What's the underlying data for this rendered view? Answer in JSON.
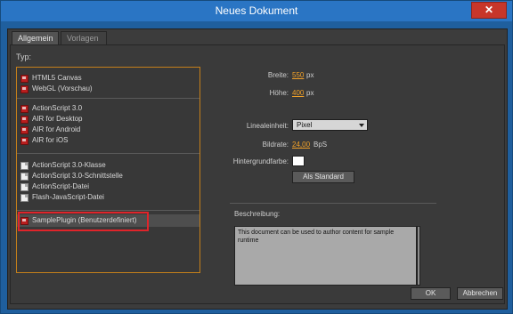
{
  "window": {
    "title": "Neues Dokument",
    "close_label": "✕"
  },
  "tabs": [
    {
      "label": "Allgemein",
      "active": true
    },
    {
      "label": "Vorlagen",
      "active": false
    }
  ],
  "typ_label": "Typ:",
  "doc_types": {
    "group1": [
      {
        "label": "HTML5 Canvas",
        "icon": "red"
      },
      {
        "label": "WebGL (Vorschau)",
        "icon": "red"
      }
    ],
    "group2": [
      {
        "label": "ActionScript 3.0",
        "icon": "red"
      },
      {
        "label": "AIR for Desktop",
        "icon": "red"
      },
      {
        "label": "AIR for Android",
        "icon": "red"
      },
      {
        "label": "AIR for iOS",
        "icon": "red"
      }
    ],
    "group3": [
      {
        "label": "ActionScript 3.0-Klasse",
        "icon": "white"
      },
      {
        "label": "ActionScript 3.0-Schnittstelle",
        "icon": "white"
      },
      {
        "label": "ActionScript-Datei",
        "icon": "white"
      },
      {
        "label": "Flash-JavaScript-Datei",
        "icon": "white"
      }
    ],
    "group4": [
      {
        "label": "SamplePlugin (Benutzerdefiniert)",
        "icon": "red",
        "selected": true
      }
    ]
  },
  "settings": {
    "width_label": "Breite:",
    "width_value": "550",
    "width_unit": "px",
    "height_label": "Höhe:",
    "height_value": "400",
    "height_unit": "px",
    "ruler_label": "Linealeinheit:",
    "ruler_value": "Pixel",
    "fps_label": "Bildrate:",
    "fps_value": "24,00",
    "fps_unit": "BpS",
    "bg_label": "Hintergrundfarbe:",
    "bg_color": "#ffffff",
    "default_button": "Als Standard"
  },
  "description": {
    "label": "Beschreibung:",
    "text": "This document can be used to author content for sample runtime"
  },
  "footer": {
    "ok": "OK",
    "cancel": "Abbrechen"
  }
}
